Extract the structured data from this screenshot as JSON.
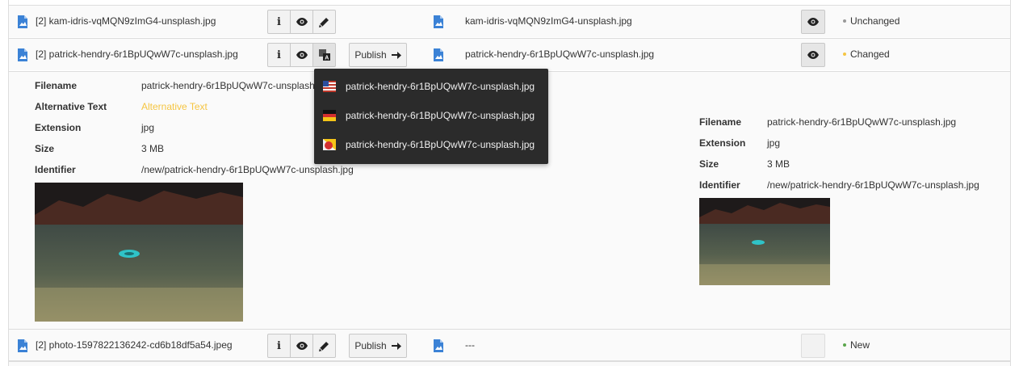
{
  "colors": {
    "unchanged": "#999999",
    "changed": "#f5c542",
    "new": "#5aa64b",
    "file_icon": "#3b82d6",
    "placeholder": "#f5c542"
  },
  "rows": [
    {
      "left_name": "[2] kam-idris-vqMQN9zImG4-unsplash.jpg",
      "right_name": "kam-idris-vqMQN9zImG4-unsplash.jpg",
      "status": "Unchanged"
    },
    {
      "left_name": "[2] patrick-hendry-6r1BpUQwW7c-unsplash.jpg",
      "right_name": "patrick-hendry-6r1BpUQwW7c-unsplash.jpg",
      "status": "Changed",
      "publish_label": "Publish"
    },
    {
      "left_name": "[2] photo-1597822136242-cd6b18df5a54.jpeg",
      "right_name": "---",
      "status": "New",
      "publish_label": "Publish"
    }
  ],
  "details_left": {
    "filename_label": "Filename",
    "filename": "patrick-hendry-6r1BpUQwW7c-unsplash.jpg",
    "alt_label": "Alternative Text",
    "alt_placeholder": "Alternative Text",
    "extension_label": "Extension",
    "extension": "jpg",
    "size_label": "Size",
    "size": "3 MB",
    "identifier_label": "Identifier",
    "identifier": "/new/patrick-hendry-6r1BpUQwW7c-unsplash.jpg"
  },
  "details_right": {
    "filename_label": "Filename",
    "filename": "patrick-hendry-6r1BpUQwW7c-unsplash.jpg",
    "extension_label": "Extension",
    "extension": "jpg",
    "size_label": "Size",
    "size": "3 MB",
    "identifier_label": "Identifier",
    "identifier": "/new/patrick-hendry-6r1BpUQwW7c-unsplash.jpg"
  },
  "language_dropdown": {
    "items": [
      {
        "flag": "us-flag-icon",
        "label": "patrick-hendry-6r1BpUQwW7c-unsplash.jpg"
      },
      {
        "flag": "de-flag-icon",
        "label": "patrick-hendry-6r1BpUQwW7c-unsplash.jpg"
      },
      {
        "flag": "mixed-flag-icon",
        "label": "patrick-hendry-6r1BpUQwW7c-unsplash.jpg"
      }
    ]
  }
}
